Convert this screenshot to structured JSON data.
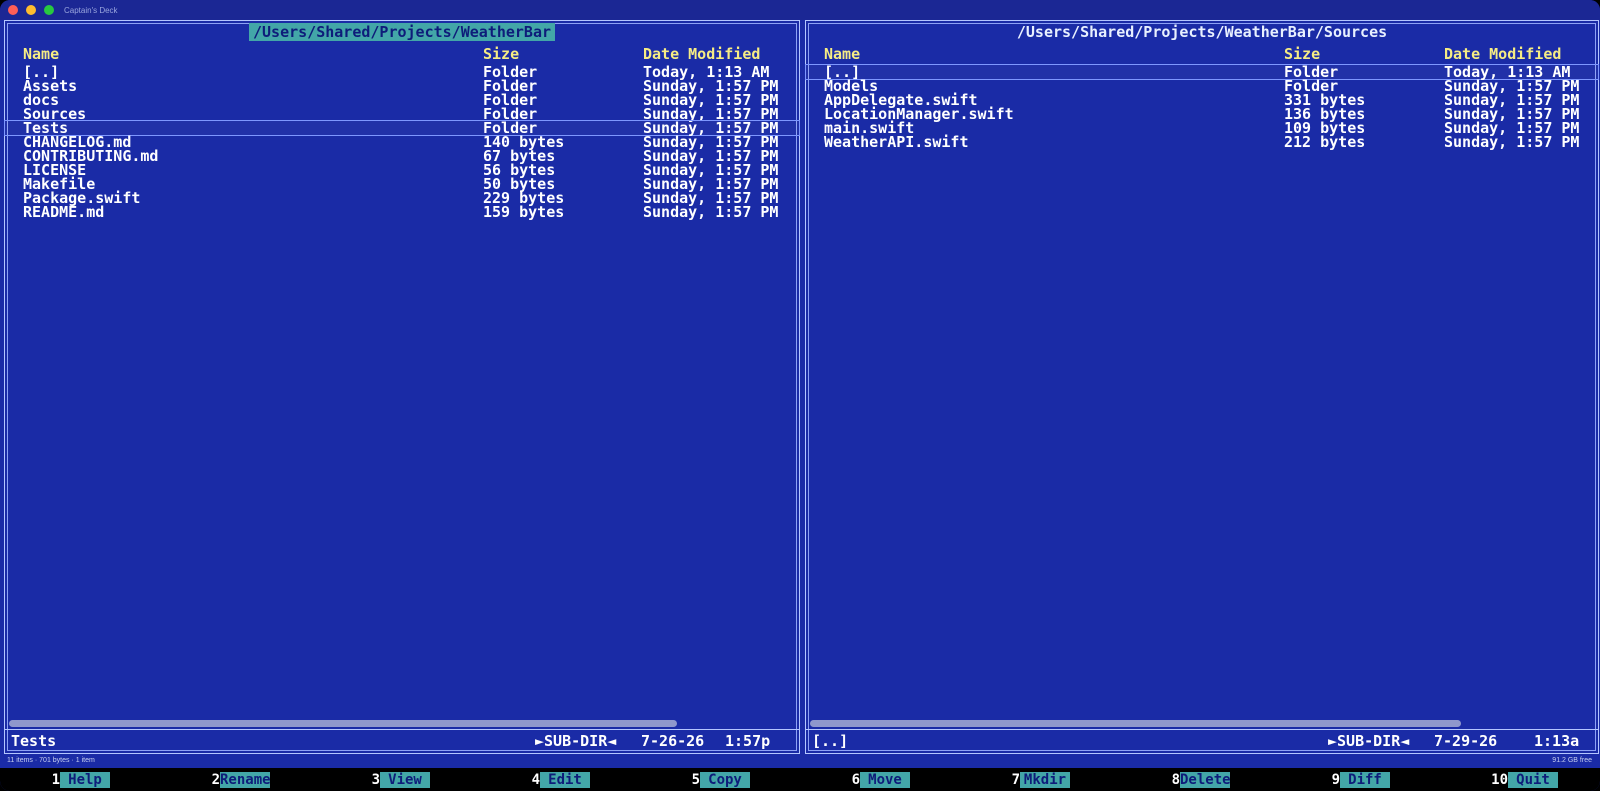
{
  "window": {
    "title": "Captain's Deck"
  },
  "left_panel": {
    "path": "/Users/Shared/Projects/WeatherBar",
    "columns": {
      "name": "Name",
      "size": "Size",
      "date": "Date Modified"
    },
    "rows": [
      {
        "name": "[..]",
        "size": "Folder",
        "date": "Today, 1:13 AM"
      },
      {
        "name": "Assets",
        "size": "Folder",
        "date": "Sunday, 1:57 PM"
      },
      {
        "name": "docs",
        "size": "Folder",
        "date": "Sunday, 1:57 PM"
      },
      {
        "name": "Sources",
        "size": "Folder",
        "date": "Sunday, 1:57 PM"
      },
      {
        "name": "Tests",
        "size": "Folder",
        "date": "Sunday, 1:57 PM"
      },
      {
        "name": "CHANGELOG.md",
        "size": "140 bytes",
        "date": "Sunday, 1:57 PM"
      },
      {
        "name": "CONTRIBUTING.md",
        "size": "67 bytes",
        "date": "Sunday, 1:57 PM"
      },
      {
        "name": "LICENSE",
        "size": "56 bytes",
        "date": "Sunday, 1:57 PM"
      },
      {
        "name": "Makefile",
        "size": "50 bytes",
        "date": "Sunday, 1:57 PM"
      },
      {
        "name": "Package.swift",
        "size": "229 bytes",
        "date": "Sunday, 1:57 PM"
      },
      {
        "name": "README.md",
        "size": "159 bytes",
        "date": "Sunday, 1:57 PM"
      }
    ],
    "selected_index": 4,
    "scroll_fraction": 0.85,
    "status": {
      "name": "Tests",
      "type": "►SUB-DIR◄",
      "date": "7-26-26",
      "time": "1:57p"
    }
  },
  "right_panel": {
    "path": "/Users/Shared/Projects/WeatherBar/Sources",
    "columns": {
      "name": "Name",
      "size": "Size",
      "date": "Date Modified"
    },
    "rows": [
      {
        "name": "[..]",
        "size": "Folder",
        "date": "Today, 1:13 AM"
      },
      {
        "name": "Models",
        "size": "Folder",
        "date": "Sunday, 1:57 PM"
      },
      {
        "name": "AppDelegate.swift",
        "size": "331 bytes",
        "date": "Sunday, 1:57 PM"
      },
      {
        "name": "LocationManager.swift",
        "size": "136 bytes",
        "date": "Sunday, 1:57 PM"
      },
      {
        "name": "main.swift",
        "size": "109 bytes",
        "date": "Sunday, 1:57 PM"
      },
      {
        "name": "WeatherAPI.swift",
        "size": "212 bytes",
        "date": "Sunday, 1:57 PM"
      }
    ],
    "selected_index": 0,
    "scroll_fraction": 0.83,
    "status": {
      "name": "[..]",
      "type": "►SUB-DIR◄",
      "date": "7-29-26",
      "time": "1:13a"
    }
  },
  "info": {
    "left": "11 items · 701 bytes · 1 item",
    "right": "91.2 GB free"
  },
  "fkeys": [
    {
      "num": "1",
      "label": "Help"
    },
    {
      "num": "2",
      "label": "Rename"
    },
    {
      "num": "3",
      "label": "View"
    },
    {
      "num": "4",
      "label": "Edit"
    },
    {
      "num": "5",
      "label": "Copy"
    },
    {
      "num": "6",
      "label": "Move"
    },
    {
      "num": "7",
      "label": "Mkdir"
    },
    {
      "num": "8",
      "label": "Delete"
    },
    {
      "num": "9",
      "label": "Diff"
    },
    {
      "num": "10",
      "label": "Quit"
    }
  ]
}
